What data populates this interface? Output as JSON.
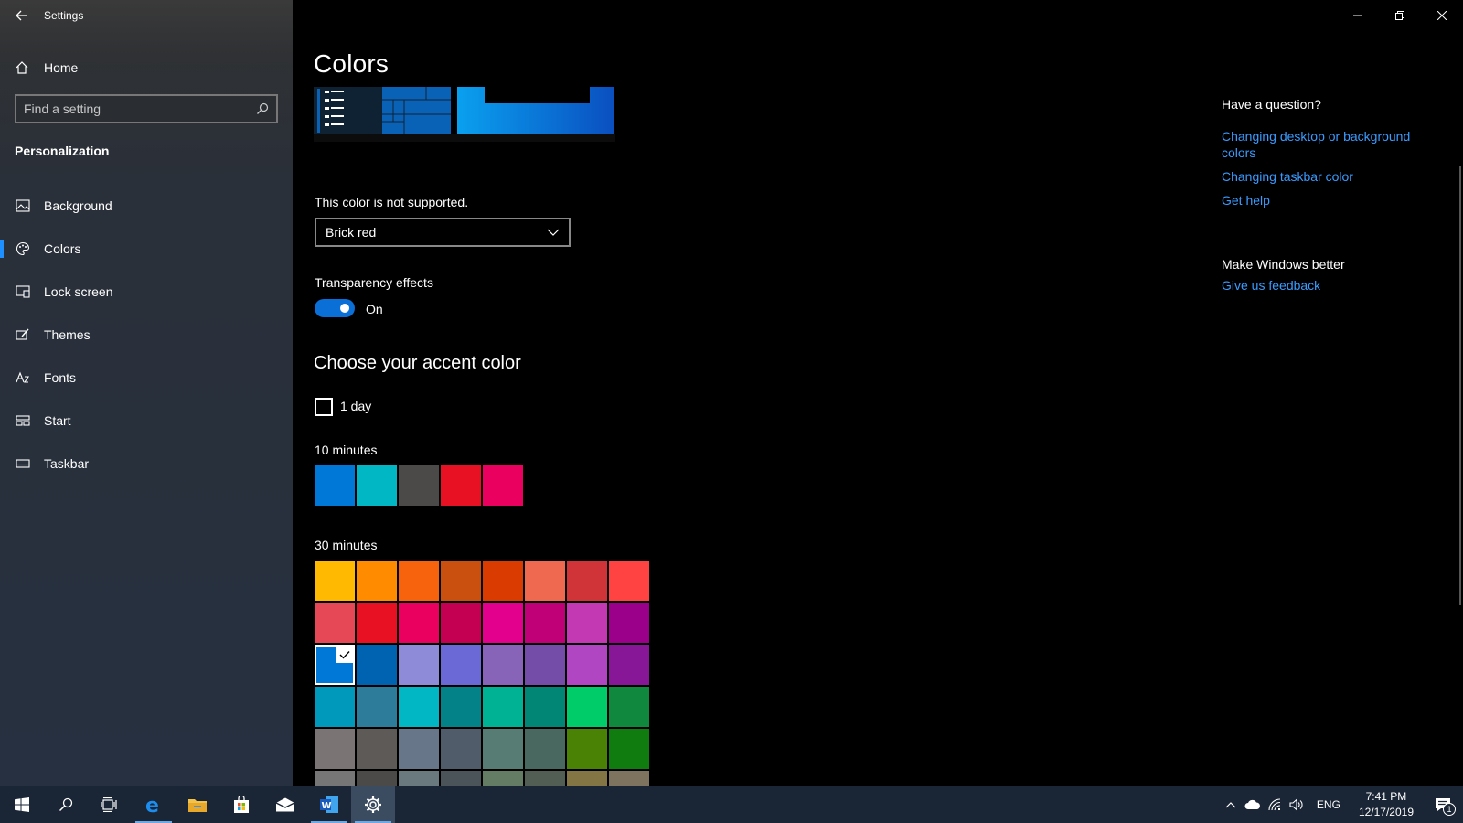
{
  "window": {
    "title": "Settings"
  },
  "sidebar": {
    "home_label": "Home",
    "search_placeholder": "Find a setting",
    "section_label": "Personalization",
    "items": [
      {
        "label": "Background",
        "icon": "image-icon"
      },
      {
        "label": "Colors",
        "icon": "palette-icon",
        "active": true
      },
      {
        "label": "Lock screen",
        "icon": "monitor-icon"
      },
      {
        "label": "Themes",
        "icon": "brush-icon"
      },
      {
        "label": "Fonts",
        "icon": "font-icon"
      },
      {
        "label": "Start",
        "icon": "start-layout-icon"
      },
      {
        "label": "Taskbar",
        "icon": "taskbar-icon"
      }
    ]
  },
  "main": {
    "title": "Colors",
    "warning": "This color is not supported.",
    "dropdown_value": "Brick red",
    "transparency_label": "Transparency effects",
    "transparency_state": "On",
    "accent_title": "Choose your accent color",
    "checkbox_label": "1 day",
    "recent_label": "10 minutes",
    "recent_colors": [
      "#0078d7",
      "#00b7c3",
      "#4c4a48",
      "#e81123",
      "#ea005e"
    ],
    "all_label": "30 minutes",
    "palette": [
      [
        "#ffb900",
        "#ff8c00",
        "#f7630c",
        "#ca5010",
        "#da3b01",
        "#ef6950",
        "#d13438",
        "#ff4343"
      ],
      [
        "#e74856",
        "#e81123",
        "#ea005e",
        "#c30052",
        "#e3008c",
        "#bf0077",
        "#c239b3",
        "#9a0089"
      ],
      [
        "#0078d7",
        "#0063b1",
        "#8e8cd8",
        "#6b69d6",
        "#8764b8",
        "#744da9",
        "#b146c2",
        "#881798"
      ],
      [
        "#0099bc",
        "#2d7d9a",
        "#00b7c3",
        "#038387",
        "#00b294",
        "#018574",
        "#00cc6a",
        "#10893e"
      ],
      [
        "#7a7574",
        "#5d5a58",
        "#68768a",
        "#515c6b",
        "#567c73",
        "#486860",
        "#498205",
        "#107c10"
      ],
      [
        "#767676",
        "#4c4a48",
        "#69797e",
        "#4a5459",
        "#647c64",
        "#525e54",
        "#847545",
        "#7e735f"
      ]
    ],
    "selected_swatch": "#0078d7"
  },
  "help": {
    "title": "Have a question?",
    "links": [
      "Changing desktop or background colors",
      "Changing taskbar color",
      "Get help"
    ],
    "better_title": "Make Windows better",
    "feedback_link": "Give us feedback"
  },
  "taskbar": {
    "apps": [
      "start-icon",
      "search-icon",
      "task-view-icon",
      "edge-icon",
      "file-explorer-icon",
      "store-icon",
      "mail-icon",
      "word-icon",
      "settings-icon"
    ],
    "language": "ENG",
    "time": "7:41 PM",
    "date": "12/17/2019",
    "notification_count": "1"
  }
}
